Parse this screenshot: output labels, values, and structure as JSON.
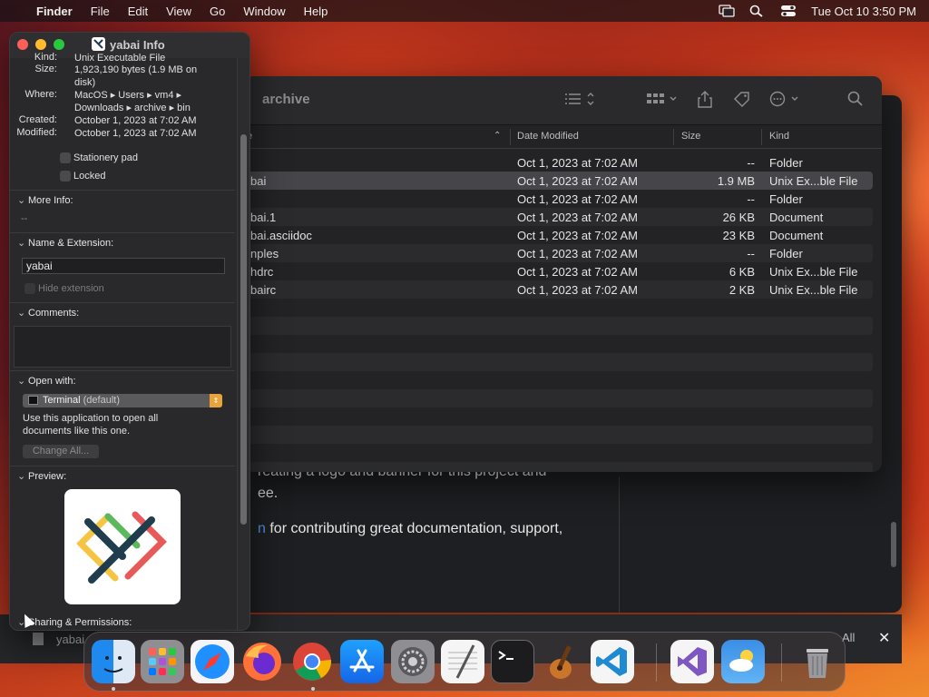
{
  "menubar": {
    "app": "Finder",
    "menus": [
      "File",
      "Edit",
      "View",
      "Go",
      "Window",
      "Help"
    ],
    "datetime": "Tue Oct 10  3:50 PM"
  },
  "doc_window": {
    "line1": "reating a logo and banner for this project and",
    "line2": "ee.",
    "link_fragment": "n",
    "line3": " for contributing great documentation, support,"
  },
  "find_bar": {
    "file_name": "yabai",
    "all_label": "All",
    "close_label": "✕"
  },
  "finder": {
    "title": "archive",
    "columns": {
      "name_sort": "e",
      "date": "Date Modified",
      "size": "Size",
      "kind": "Kind"
    },
    "rows": [
      {
        "name": "",
        "date": "Oct 1, 2023 at 7:02 AM",
        "size": "--",
        "kind": "Folder"
      },
      {
        "name": "bai",
        "date": "Oct 1, 2023 at 7:02 AM",
        "size": "1.9 MB",
        "kind": "Unix Ex...ble File"
      },
      {
        "name": "",
        "date": "Oct 1, 2023 at 7:02 AM",
        "size": "--",
        "kind": "Folder"
      },
      {
        "name": "bai.1",
        "date": "Oct 1, 2023 at 7:02 AM",
        "size": "26 KB",
        "kind": "Document"
      },
      {
        "name": "bai.asciidoc",
        "date": "Oct 1, 2023 at 7:02 AM",
        "size": "23 KB",
        "kind": "Document"
      },
      {
        "name": "nples",
        "date": "Oct 1, 2023 at 7:02 AM",
        "size": "--",
        "kind": "Folder"
      },
      {
        "name": "hdrc",
        "date": "Oct 1, 2023 at 7:02 AM",
        "size": "6 KB",
        "kind": "Unix Ex...ble File"
      },
      {
        "name": "bairc",
        "date": "Oct 1, 2023 at 7:02 AM",
        "size": "2 KB",
        "kind": "Unix Ex...ble File"
      }
    ]
  },
  "info": {
    "title": "yabai Info",
    "kind_label": "Kind:",
    "kind_value": "Unix Executable File",
    "size_label": "Size:",
    "size_value": "1,923,190 bytes (1.9 MB on disk)",
    "where_label": "Where:",
    "where_value": "MacOS ▸ Users ▸ vm4 ▸ Downloads ▸ archive ▸ bin",
    "created_label": "Created:",
    "created_value": "October 1, 2023 at 7:02 AM",
    "modified_label": "Modified:",
    "modified_value": "October 1, 2023 at 7:02 AM",
    "stationery_label": "Stationery pad",
    "locked_label": "Locked",
    "more_info_label": "More Info:",
    "more_info_value": "--",
    "name_ext_label": "Name & Extension:",
    "name_value": "yabai",
    "hide_ext_label": "Hide extension",
    "comments_label": "Comments:",
    "open_with_label": "Open with:",
    "open_with_app": "Terminal",
    "open_with_default": " (default)",
    "open_with_desc": "Use this application to open all documents like this one.",
    "change_all_label": "Change All...",
    "preview_label": "Preview:",
    "sharing_label": "Sharing & Permissions:"
  },
  "dock": {
    "apps": [
      "finder-icon",
      "launchpad-icon",
      "safari-icon",
      "firefox-icon",
      "chrome-icon",
      "app-store-icon",
      "system-settings-icon",
      "textedit-icon",
      "terminal-icon",
      "garageband-icon",
      "vscode-icon",
      "visual-studio-icon",
      "weather-icon",
      "trash-icon"
    ]
  },
  "colors": {
    "accent": "#4f93e8",
    "selection": "#46464a",
    "close": "#ff5f57",
    "minimize": "#febc2e",
    "maximize": "#28c840"
  }
}
